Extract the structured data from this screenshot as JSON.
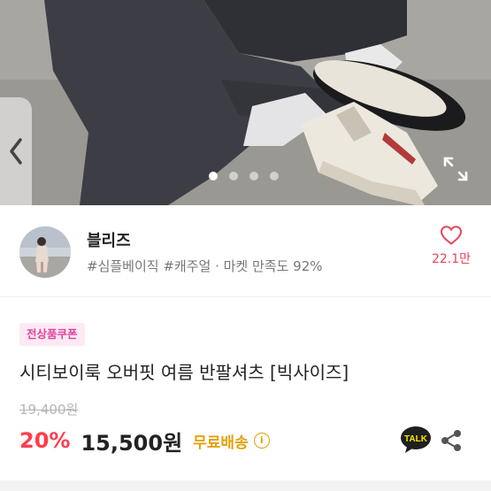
{
  "gallery": {
    "image_icon": "product-photo",
    "slide_count": 4,
    "active_slide": 1,
    "prev_icon": "chevron-left-icon",
    "expand_icon": "expand-icon"
  },
  "seller": {
    "name": "블리즈",
    "tags": "#심플베이직 #캐주얼 · 마켓 만족도 92%",
    "like_count": "22.1만",
    "like_icon": "heart-outline-icon"
  },
  "product": {
    "coupon_badge": "전상품쿠폰",
    "title": "시티보이룩 오버핏 여름 반팔셔츠 [빅사이즈]",
    "original_price": "19,400원",
    "discount": "20%",
    "price": "15,500원",
    "shipping": "무료배송",
    "info_icon": "i",
    "talk_label": "TALK",
    "share_icon": "share-icon"
  },
  "colors": {
    "accent_pink": "#e0449d",
    "discount_red": "#ff3d4f",
    "shipping_yellow": "#e3a10a",
    "heart_red": "#e8455e"
  }
}
